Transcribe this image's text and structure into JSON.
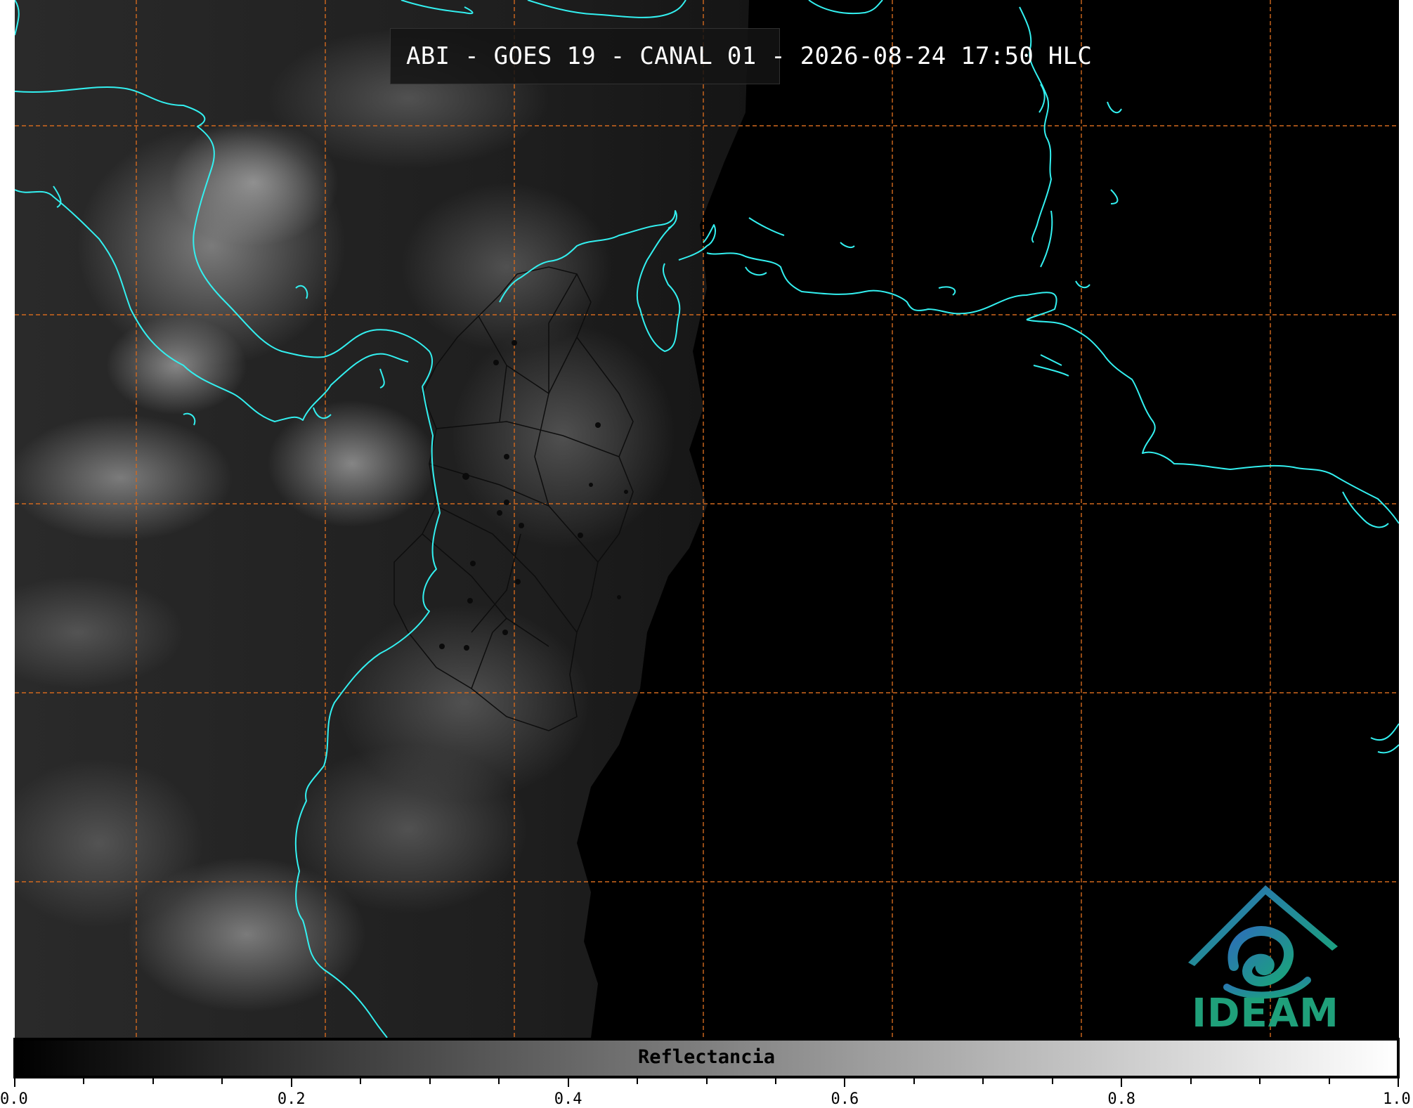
{
  "title": "ABI - GOES 19 - CANAL 01 - 2026-08-24 17:50 HLC",
  "logo": {
    "text": "IDEAM"
  },
  "colorbar": {
    "label": "Reflectancia",
    "min": 0.0,
    "max": 1.0,
    "tick_labels": [
      "0.0",
      "0.2",
      "0.4",
      "0.6",
      "0.8",
      "1.0"
    ],
    "colormap": "grayscale",
    "color_low": "#000000",
    "color_high": "#ffffff"
  },
  "map": {
    "coastline_color": "#33f0f0",
    "gridline_color": "#d2691e",
    "border_color": "#111111",
    "gridline_style": "dashed"
  }
}
